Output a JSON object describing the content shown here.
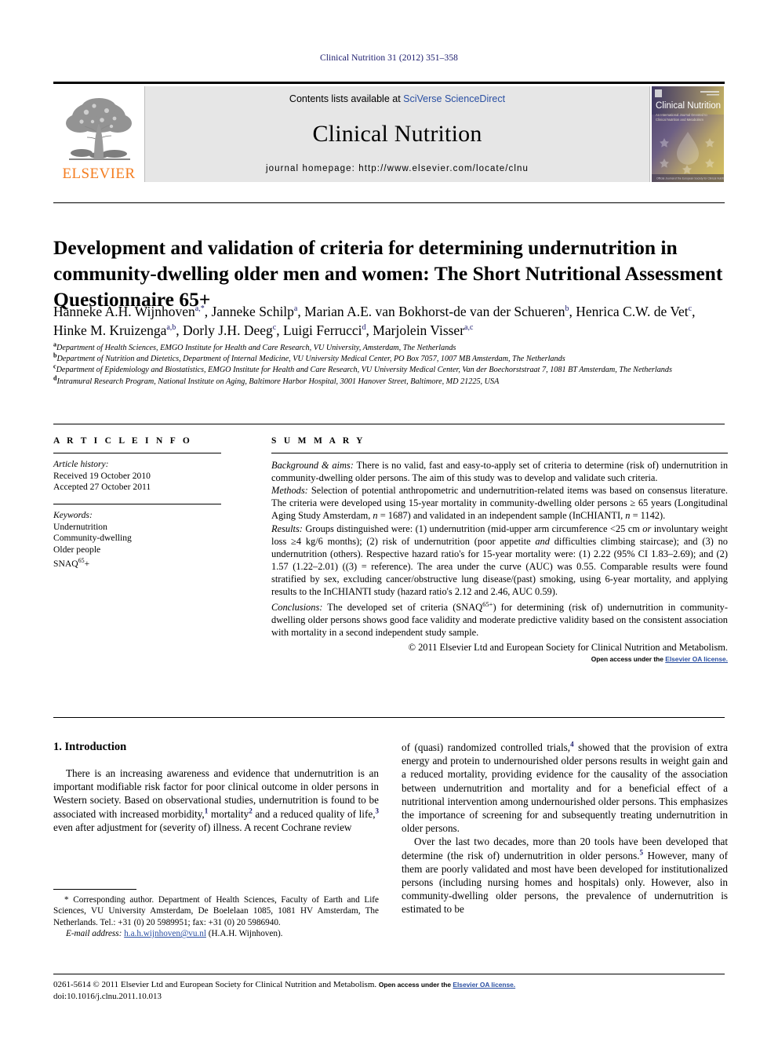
{
  "running_head": "Clinical Nutrition 31 (2012) 351–358",
  "masthead": {
    "publisher_name": "ELSEVIER",
    "contents_prefix": "Contents lists available at ",
    "contents_link": "SciVerse ScienceDirect",
    "journal_title": "Clinical Nutrition",
    "homepage": "journal homepage: http://www.elsevier.com/locate/clnu",
    "cover": {
      "title": "Clinical Nutrition",
      "subtitle": "An International Journal Devoted to Clinical Nutrition and Metabolism",
      "footer": "Official Journal of the European Society for Clinical Nutrition and Metabolism"
    }
  },
  "article": {
    "title": "Development and validation of criteria for determining undernutrition in community-dwelling older men and women: The Short Nutritional Assessment Questionnaire 65+",
    "authors_line_1": "Hanneke A.H. Wijnhoven",
    "authors": [
      {
        "name": "Hanneke A.H. Wijnhoven",
        "marks": "a,*"
      },
      {
        "name": "Janneke Schilp",
        "marks": "a"
      },
      {
        "name": "Marian A.E. van Bokhorst-de van der Schueren",
        "marks": "b"
      },
      {
        "name": "Henrica C.W. de Vet",
        "marks": "c"
      },
      {
        "name": "Hinke M. Kruizenga",
        "marks": "a,b"
      },
      {
        "name": "Dorly J.H. Deeg",
        "marks": "c"
      },
      {
        "name": "Luigi Ferrucci",
        "marks": "d"
      },
      {
        "name": "Marjolein Visser",
        "marks": "a,c"
      }
    ],
    "affiliations": [
      {
        "mark": "a",
        "text": "Department of Health Sciences, EMGO Institute for Health and Care Research, VU University, Amsterdam, The Netherlands"
      },
      {
        "mark": "b",
        "text": "Department of Nutrition and Dietetics, Department of Internal Medicine, VU University Medical Center, PO Box 7057, 1007 MB Amsterdam, The Netherlands"
      },
      {
        "mark": "c",
        "text": "Department of Epidemiology and Biostatistics, EMGO Institute for Health and Care Research, VU University Medical Center, Van der Boechorststraat 7, 1081 BT Amsterdam, The Netherlands"
      },
      {
        "mark": "d",
        "text": "Intramural Research Program, National Institute on Aging, Baltimore Harbor Hospital, 3001 Hanover Street, Baltimore, MD 21225, USA"
      }
    ]
  },
  "article_info": {
    "heading": "A R T I C L E  I N F O",
    "history_label": "Article history:",
    "received": "Received 19 October 2010",
    "accepted": "Accepted 27 October 2011",
    "keywords_label": "Keywords:",
    "keywords": [
      "Undernutrition",
      "Community-dwelling",
      "Older people",
      "SNAQ65+"
    ],
    "keyword_snaq_base": "SNAQ",
    "keyword_snaq_sup": "65",
    "keyword_snaq_tail": "+"
  },
  "summary": {
    "heading": "S U M M A R Y",
    "background_label": "Background & aims:",
    "background_text": " There is no valid, fast and easy-to-apply set of criteria to determine (risk of) undernutrition in community-dwelling older persons. The aim of this study was to develop and validate such criteria.",
    "methods_label": "Methods:",
    "methods_text_1": " Selection of potential anthropometric and undernutrition-related items was based on consensus literature. The criteria were developed using 15-year mortality in community-dwelling older persons ≥ 65 years (Longitudinal Aging Study Amsterdam, ",
    "methods_n1": "n",
    "methods_text_2": " = 1687) and validated in an independent sample (InCHIANTI, ",
    "methods_n2": "n",
    "methods_text_3": " = 1142).",
    "results_label": "Results:",
    "results_text_1": " Groups distinguished were: (1) undernutrition (mid-upper arm circumference <25 cm ",
    "results_or": "or",
    "results_text_2": " involuntary weight loss ≥4 kg/6 months); (2) risk of undernutrition (poor appetite ",
    "results_and": "and",
    "results_text_3": " difficulties climbing staircase); and (3) no undernutrition (others). Respective hazard ratio's for 15-year mortality were: (1) 2.22 (95% CI 1.83–2.69); and (2) 1.57 (1.22–2.01) ((3) = reference). The area under the curve (AUC) was 0.55. Comparable results were found stratified by sex, excluding cancer/obstructive lung disease/(past) smoking, using 6-year mortality, and applying results to the InCHIANTI study (hazard ratio's 2.12 and 2.46, AUC 0.59).",
    "conclusions_label": "Conclusions:",
    "conclusions_text_1": " The developed set of criteria (SNAQ",
    "conclusions_sup": "65+",
    "conclusions_text_2": ") for determining (risk of) undernutrition in community-dwelling older persons shows good face validity and moderate predictive validity based on the consistent association with mortality in a second independent study sample.",
    "copyright": "© 2011 Elsevier Ltd and European Society for Clinical Nutrition and Metabolism.",
    "open_access_prefix": "Open access under the ",
    "open_access_link": "Elsevier OA license."
  },
  "body": {
    "section_heading": "1. Introduction",
    "left_paragraph_1_a": "There is an increasing awareness and evidence that undernutrition is an important modifiable risk factor for poor clinical outcome in older persons in Western society. Based on observational studies, undernutrition is found to be associated with increased morbidity,",
    "left_sup_1": "1",
    "left_paragraph_1_b": " mortality",
    "left_sup_2": "2",
    "left_paragraph_1_c": " and a reduced quality of life,",
    "left_sup_3": "3",
    "left_paragraph_1_d": " even after adjustment for (severity of) illness. A recent Cochrane review",
    "right_paragraph_1_a": "of (quasi) randomized controlled trials,",
    "right_sup_4": "4",
    "right_paragraph_1_b": " showed that the provision of extra energy and protein to undernourished older persons results in weight gain and a reduced mortality, providing evidence for the causality of the association between undernutrition and mortality and for a beneficial effect of a nutritional intervention among undernourished older persons. This emphasizes the importance of screening for and subsequently treating undernutrition in older persons.",
    "right_paragraph_2_a": "Over the last two decades, more than 20 tools have been developed that determine (the risk of) undernutrition in older persons.",
    "right_sup_5": "5",
    "right_paragraph_2_b": " However, many of them are poorly validated and most have been developed for institutionalized persons (including nursing homes and hospitals) only. However, also in community-dwelling older persons, the prevalence of undernutrition is estimated to be"
  },
  "footnote": {
    "corresponding": "* Corresponding author. Department of Health Sciences, Faculty of Earth and Life Sciences, VU University Amsterdam, De Boelelaan 1085, 1081 HV Amsterdam, The Netherlands. Tel.: +31 (0) 20 5989951; fax: +31 (0) 20 5986940.",
    "email_label": "E-mail address:",
    "email": "h.a.h.wijnhoven@vu.nl",
    "email_suffix": " (H.A.H. Wijnhoven)."
  },
  "bottom_matter": {
    "issn_line": "0261-5614 © 2011 Elsevier Ltd and European Society for Clinical Nutrition and Metabolism. ",
    "oa_prefix": "Open access under the ",
    "oa_link": "Elsevier OA license.",
    "doi_line": "doi:10.1016/j.clnu.2011.10.013"
  },
  "colors": {
    "link": "#2a4fa2",
    "running_head": "#19196b",
    "elsevier_orange": "#f47d20",
    "band_gray": "#e6e6e6"
  }
}
